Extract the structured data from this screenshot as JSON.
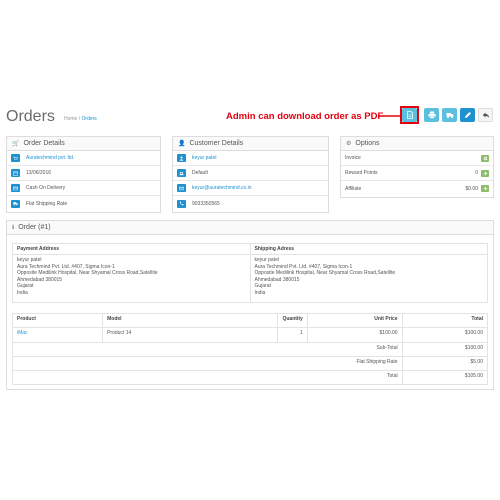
{
  "header": {
    "title": "Orders",
    "breadcrumb": [
      "Home",
      "Orders"
    ],
    "breadcrumb_sep": "/",
    "annotation": "Admin can download order as PDF"
  },
  "toolbar": [
    {
      "name": "download-pdf-button",
      "icon": "pdf-icon",
      "color": "#5bc0de"
    },
    {
      "name": "print-invoice-button",
      "icon": "print-icon",
      "color": "#5bc0de"
    },
    {
      "name": "print-shipping-button",
      "icon": "truck-icon",
      "color": "#5bc0de"
    },
    {
      "name": "edit-button",
      "icon": "pencil-icon",
      "color": "#1e91cf"
    },
    {
      "name": "back-button",
      "icon": "reply-icon",
      "color": "#f5f5f5"
    }
  ],
  "order_details": {
    "title": "Order Details",
    "rows": [
      {
        "icon": "cart-icon",
        "value": "Auratechmind pvt. ltd.",
        "link": true
      },
      {
        "icon": "calendar-icon",
        "value": "13/06/2016",
        "link": false
      },
      {
        "icon": "credit-card-icon",
        "value": "Cash On Delivery",
        "link": false
      },
      {
        "icon": "truck-icon",
        "value": "Flat Shipping Rate",
        "link": false
      }
    ]
  },
  "customer_details": {
    "title": "Customer Details",
    "rows": [
      {
        "icon": "user-icon",
        "value": "keyur patel",
        "link": true
      },
      {
        "icon": "group-icon",
        "value": "Default",
        "link": false
      },
      {
        "icon": "envelope-icon",
        "value": "keyur@auratechmind.co.in",
        "link": true
      },
      {
        "icon": "phone-icon",
        "value": "9033350565",
        "link": false
      }
    ]
  },
  "options": {
    "title": "Options",
    "rows": [
      {
        "label": "Invoice",
        "amount": ""
      },
      {
        "label": "Reward Points",
        "amount": "0"
      },
      {
        "label": "Affiliate",
        "amount": "$0.00"
      }
    ]
  },
  "order": {
    "title": "Order (#1)",
    "payment_address_title": "Payment Address",
    "shipping_address_title": "Shipping Adress",
    "payment_address": [
      "keyur patel",
      "Aura Techmind Pvt. Ltd. #407, Sigma Icon-1",
      "Opposite Medilink Hospital, Near Shyamal Cross Road,Satellite",
      "Ahmedabad 380015",
      "Gujarat",
      "India"
    ],
    "shipping_address": [
      "keyur patel",
      "Aura Techmind Pvt. Ltd. #407, Sigma Icon-1",
      "Opposite Medilink Hospital, Near Shyamal Cross Road,Satellite",
      "Ahmedabad 380015",
      "Gujarat",
      "India"
    ],
    "columns": [
      "Product",
      "Model",
      "Quantity",
      "Unit Price",
      "Total"
    ],
    "items": [
      {
        "product": "iMac",
        "model": "Product 14",
        "quantity": "1",
        "unit_price": "$100.00",
        "total": "$100.00"
      }
    ],
    "totals": [
      {
        "label": "Sub-Total",
        "value": "$100.00"
      },
      {
        "label": "Flat Shipping Rate",
        "value": "$5.00"
      },
      {
        "label": "Total",
        "value": "$105.00"
      }
    ]
  }
}
